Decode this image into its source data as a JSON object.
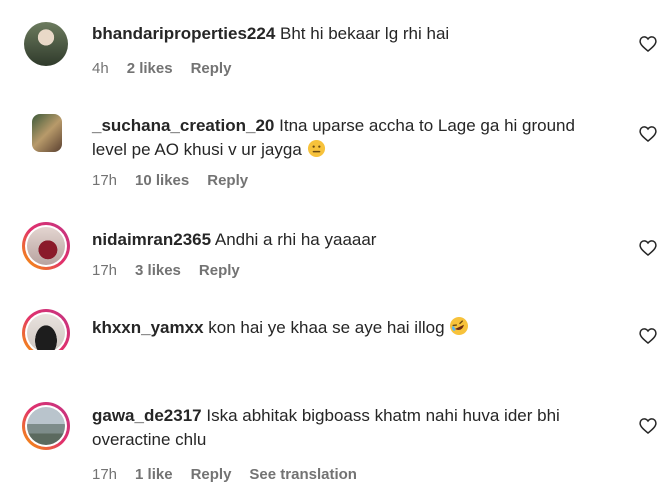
{
  "comments": [
    {
      "username": "bhandariproperties224",
      "text": "Bht hi bekaar lg rhi hai",
      "time": "4h",
      "likes": "2 likes",
      "reply": "Reply"
    },
    {
      "username": "_suchana_creation_20",
      "text": "Itna uparse accha to Lage ga hi ground level pe AO khusi v ur jayga",
      "emoji": "neutral-face-emoji",
      "time": "17h",
      "likes": "10 likes",
      "reply": "Reply"
    },
    {
      "username": "nidaimran2365",
      "text": "Andhi a rhi ha yaaaar",
      "time": "17h",
      "likes": "3 likes",
      "reply": "Reply"
    },
    {
      "username": "khxxn_yamxx",
      "text": "kon hai ye khaa se aye hai illog",
      "emoji": "rofl-emoji",
      "time": "",
      "likes": "",
      "reply": ""
    },
    {
      "username": "gawa_de2317",
      "text": "Iska abhitak bigboass khatm nahi huva ider bhi overactine chlu",
      "time": "17h",
      "likes": "1 like",
      "reply": "Reply",
      "see_translation": "See translation"
    }
  ],
  "icons": {
    "like": "heart-outline-icon"
  },
  "colors": {
    "text": "#262626",
    "secondary": "#737373",
    "story_ring_start": "#f9a100",
    "story_ring_end": "#c13584"
  }
}
